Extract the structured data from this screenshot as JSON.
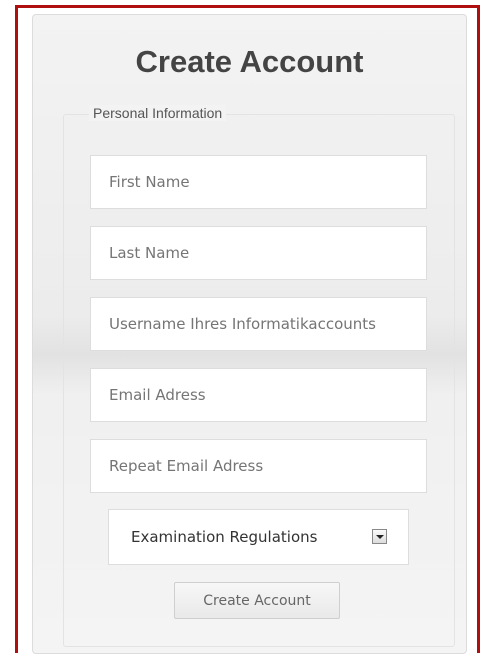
{
  "form": {
    "title": "Create Account",
    "section_legend": "Personal Information",
    "fields": [
      {
        "placeholder": "First Name"
      },
      {
        "placeholder": "Last Name"
      },
      {
        "placeholder": "Username Ihres Informatikaccounts"
      },
      {
        "placeholder": "Email Adress"
      },
      {
        "placeholder": "Repeat Email Adress"
      }
    ],
    "select": {
      "selected": "Examination Regulations",
      "icon": "dropdown-arrow-icon"
    },
    "submit_label": "Create Account",
    "colors": {
      "frame_border": "#b00f0f",
      "panel_bg": "#f3f3f3",
      "title_text": "#444444"
    }
  }
}
